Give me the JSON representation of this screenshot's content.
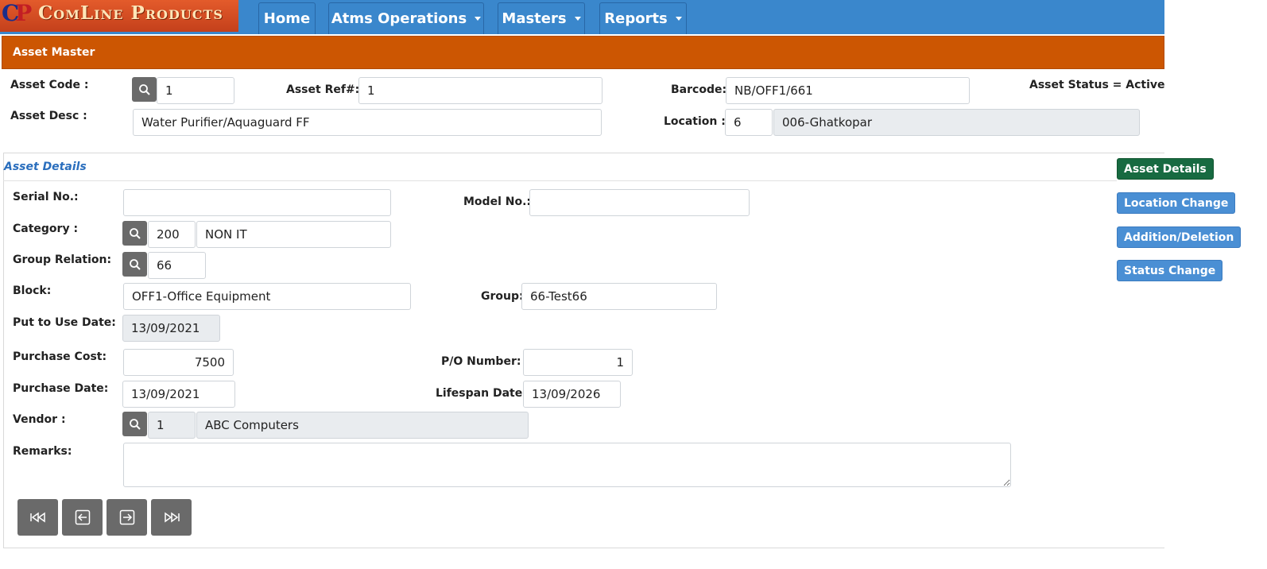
{
  "app": {
    "logo_initials_c": "C",
    "logo_initials_p": "P",
    "logo_text": "ComLine Products"
  },
  "nav": {
    "home": "Home",
    "atms_operations": "Atms Operations",
    "masters": "Masters",
    "reports": "Reports"
  },
  "page": {
    "title": "Asset Master"
  },
  "header_form": {
    "asset_code_label": "Asset Code :",
    "asset_code_value": "1",
    "asset_ref_label": "Asset Ref#:",
    "asset_ref_value": "1",
    "barcode_label": "Barcode:",
    "barcode_value": "NB/OFF1/661",
    "asset_status_text": "Asset Status = Active",
    "asset_desc_label": "Asset Desc :",
    "asset_desc_value": "Water Purifier/Aquaguard FF",
    "location_label": "Location :",
    "location_code": "6",
    "location_name": "006-Ghatkopar"
  },
  "details": {
    "section_title": "Asset Details",
    "serial_label": "Serial No.:",
    "serial_value": "",
    "model_label": "Model No.:",
    "model_value": "",
    "category_label": "Category :",
    "category_code": "200",
    "category_name": "NON IT",
    "group_relation_label": "Group Relation:",
    "group_relation_value": "66",
    "block_label": "Block:",
    "block_value": "OFF1-Office Equipment",
    "group_label": "Group:",
    "group_value": "66-Test66",
    "put_to_use_label": "Put to Use Date:",
    "put_to_use_value": "13/09/2021",
    "purchase_cost_label": "Purchase Cost:",
    "purchase_cost_value": "7500",
    "po_number_label": "P/O Number:",
    "po_number_value": "1",
    "purchase_date_label": "Purchase Date:",
    "purchase_date_value": "13/09/2021",
    "lifespan_label": "Lifespan Date:",
    "lifespan_value": "13/09/2026",
    "vendor_label": "Vendor :",
    "vendor_code": "1",
    "vendor_name": "ABC Computers",
    "remarks_label": "Remarks:",
    "remarks_value": ""
  },
  "side_buttons": {
    "asset_details": "Asset Details",
    "location_change": "Location Change",
    "addition_deletion": "Addition/Deletion",
    "status_change": "Status Change"
  },
  "colors": {
    "navbar": "#3a87cc",
    "title_bar": "#cc5602",
    "active_tab": "#176a41",
    "side_tab": "#4a8fd4",
    "section_title": "#2a6ebd",
    "icon_button": "#6a6a6a"
  },
  "icons": {
    "search": "search-icon",
    "first": "first-record-icon",
    "previous": "previous-record-icon",
    "next": "next-record-icon",
    "last": "last-record-icon"
  }
}
